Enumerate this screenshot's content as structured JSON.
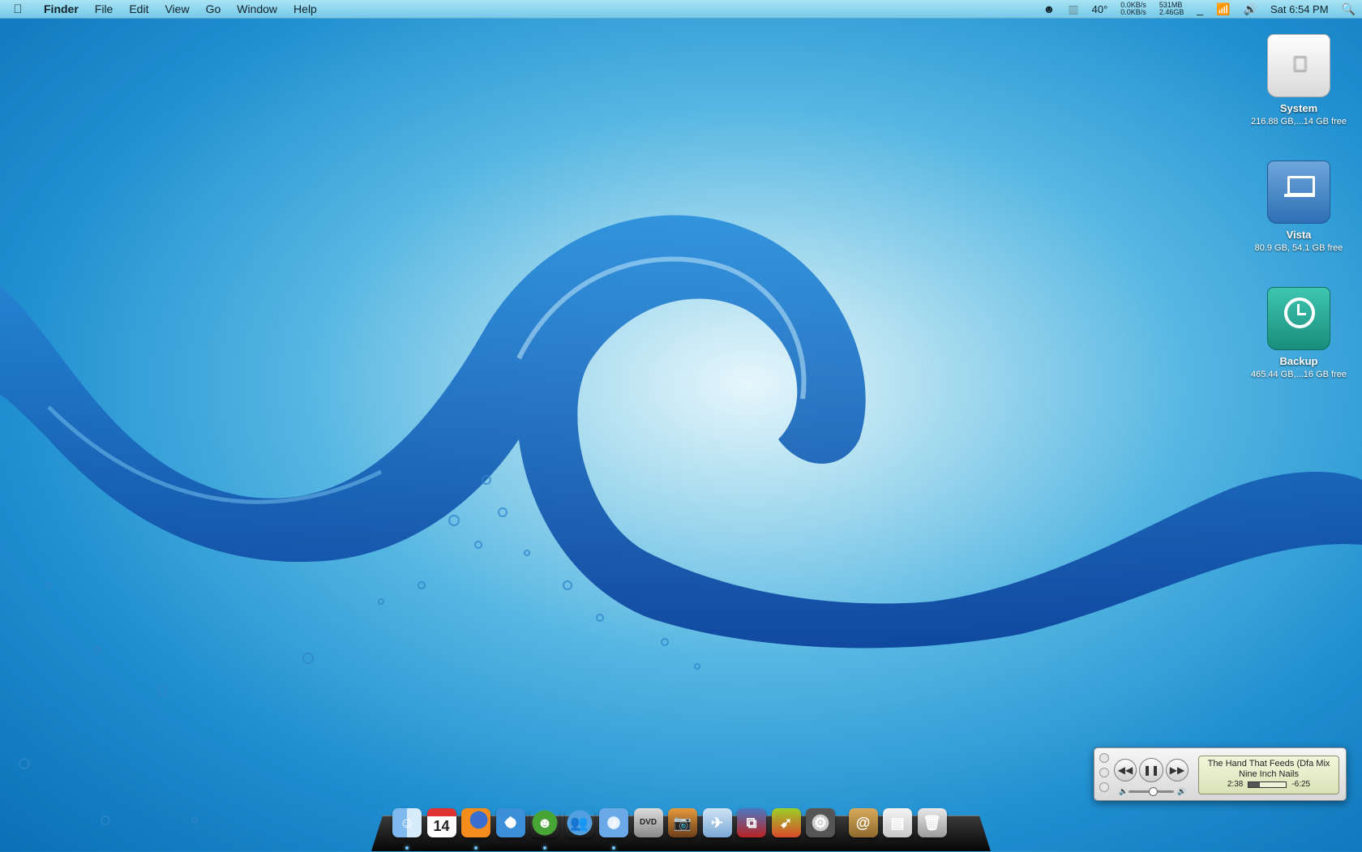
{
  "menubar": {
    "app_name": "Finder",
    "menus": [
      "File",
      "Edit",
      "View",
      "Go",
      "Window",
      "Help"
    ],
    "status": {
      "temperature": "40°",
      "net_up": "0.0KB/s",
      "net_down": "0.0KB/s",
      "mem_used": "531MB",
      "mem_free": "2.46GB",
      "clock": "Sat 6:54 PM"
    }
  },
  "desktop": {
    "disks": [
      {
        "name": "System",
        "info": "216.88 GB,...14 GB free",
        "icon": "hard-drive-icon"
      },
      {
        "name": "Vista",
        "info": "80.9 GB, 54.1 GB free",
        "icon": "external-drive-icon"
      },
      {
        "name": "Backup",
        "info": "465.44 GB,...16 GB free",
        "icon": "time-machine-drive-icon"
      }
    ]
  },
  "mini_player": {
    "track": "The Hand That Feeds (Dfa Mix",
    "artist": "Nine Inch Nails",
    "elapsed": "2:38",
    "remaining": "-6:25",
    "progress": 0.3,
    "volume": 0.5
  },
  "dock": {
    "items": [
      {
        "name": "finder-icon",
        "running": true
      },
      {
        "name": "ical-icon",
        "label": "14",
        "running": false
      },
      {
        "name": "firefox-icon",
        "running": true
      },
      {
        "name": "safari-icon",
        "running": false
      },
      {
        "name": "adium-icon",
        "running": true
      },
      {
        "name": "messenger-icon",
        "running": false
      },
      {
        "name": "itunes-icon",
        "running": true
      },
      {
        "name": "dvd-player-icon",
        "running": false
      },
      {
        "name": "iphoto-icon",
        "running": false
      },
      {
        "name": "mail-app-icon",
        "running": false
      },
      {
        "name": "vmware-icon",
        "running": false
      },
      {
        "name": "transmit-icon",
        "running": false
      },
      {
        "name": "system-preferences-icon",
        "running": false
      },
      {
        "name": "address-book-icon",
        "running": false
      },
      {
        "name": "downloads-stack-icon",
        "running": false
      },
      {
        "name": "trash-icon",
        "running": false
      }
    ]
  }
}
